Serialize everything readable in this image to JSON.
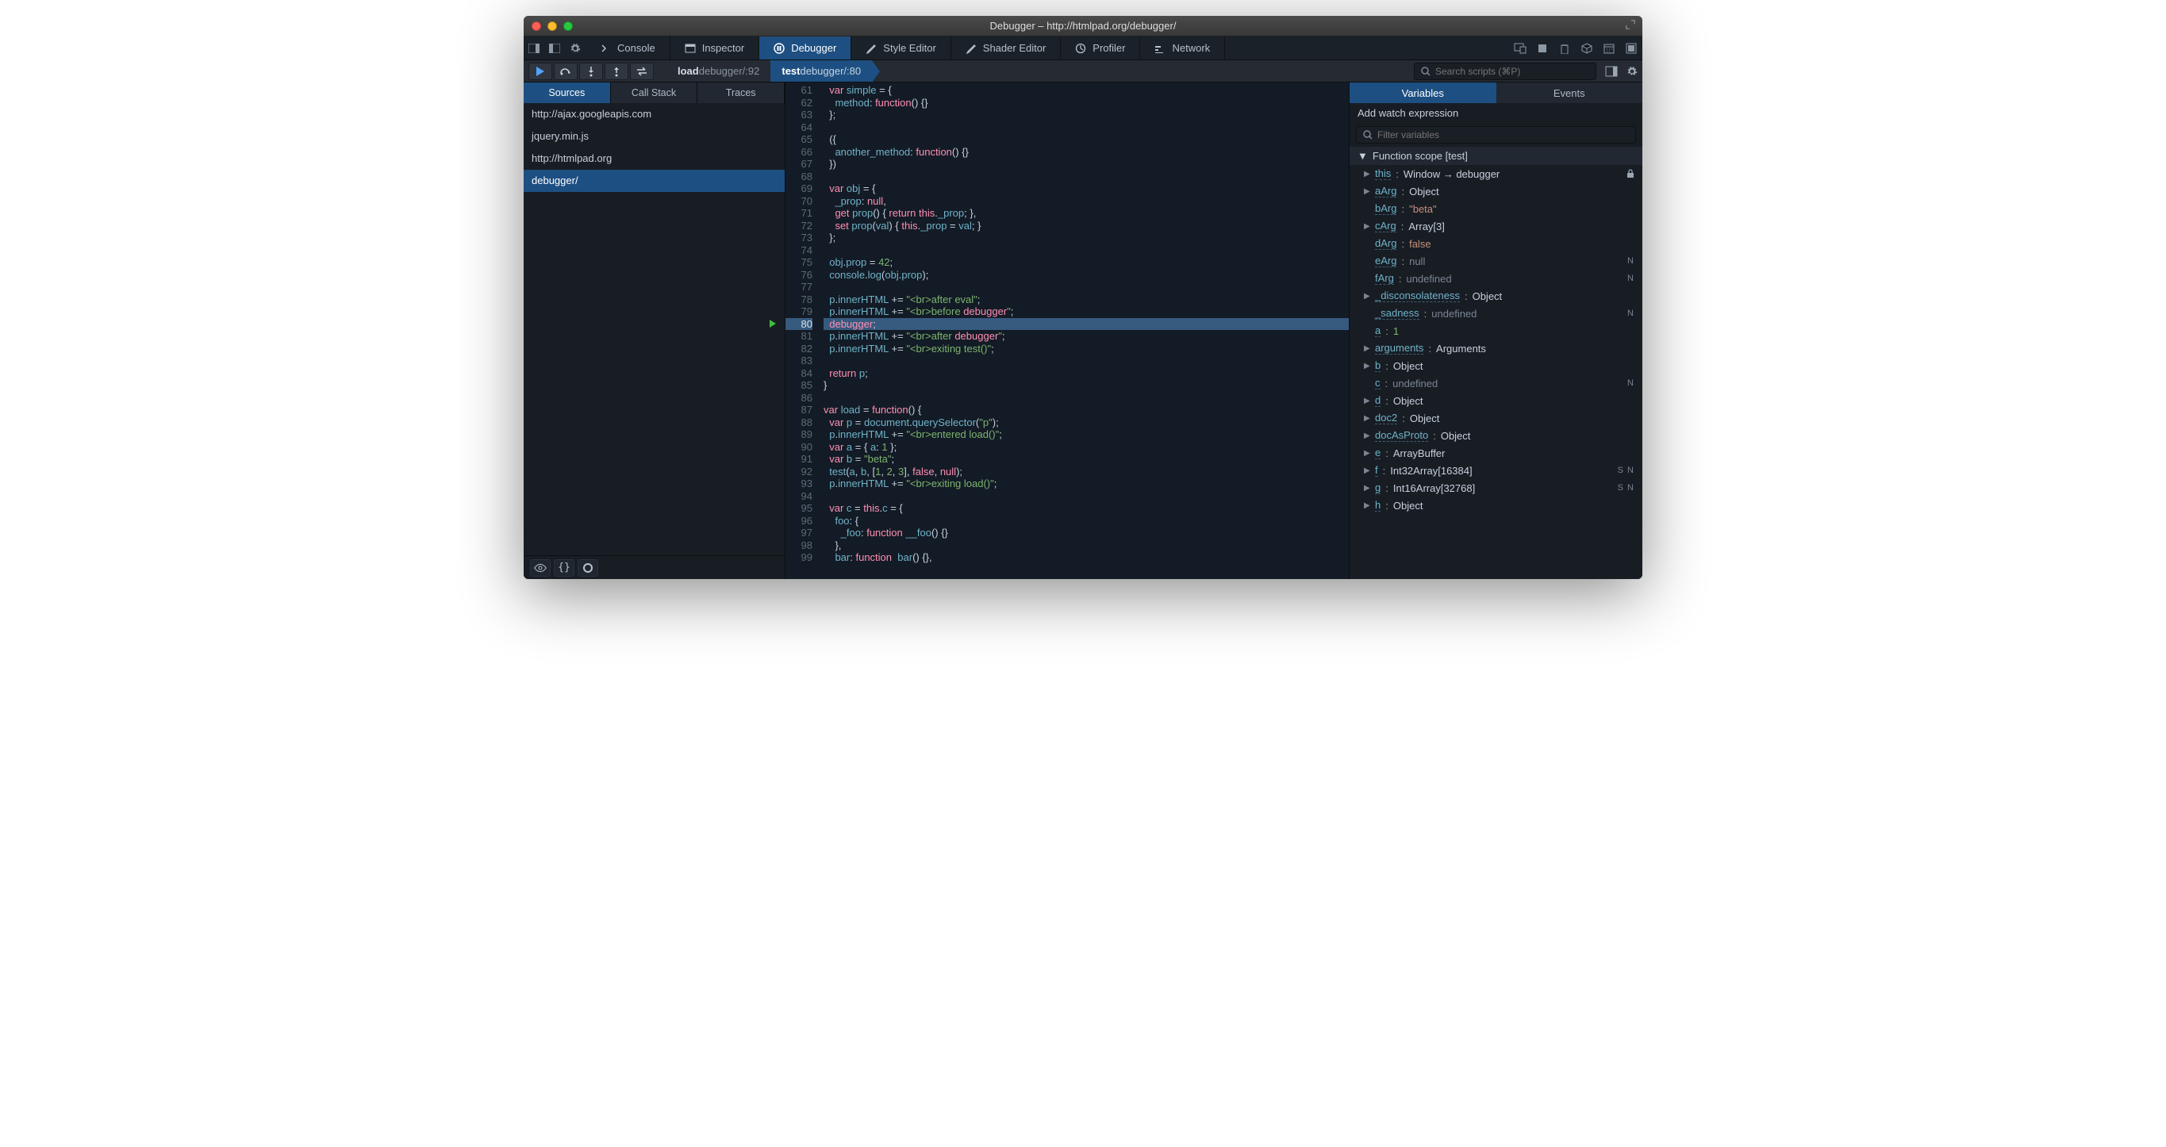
{
  "window": {
    "title": "Debugger – http://htmlpad.org/debugger/"
  },
  "tools": {
    "items": [
      {
        "label": "Console"
      },
      {
        "label": "Inspector"
      },
      {
        "label": "Debugger",
        "active": true
      },
      {
        "label": "Style Editor"
      },
      {
        "label": "Shader Editor"
      },
      {
        "label": "Profiler"
      },
      {
        "label": "Network"
      }
    ]
  },
  "breadcrumb": {
    "segments": [
      {
        "prefix": "load",
        "loc": " debugger/:92"
      },
      {
        "prefix": "test",
        "loc": " debugger/:80",
        "active": true
      }
    ]
  },
  "search": {
    "placeholder": "Search scripts (⌘P)"
  },
  "sidebar": {
    "tabs": [
      "Sources",
      "Call Stack",
      "Traces"
    ],
    "activeTab": 0,
    "sources": [
      {
        "label": "http://ajax.googleapis.com"
      },
      {
        "label": "jquery.min.js"
      },
      {
        "label": "http://htmlpad.org"
      },
      {
        "label": "debugger/",
        "selected": true
      }
    ]
  },
  "editor": {
    "firstLine": 61,
    "currentLine": 80,
    "lines": [
      "  var simple = {",
      "    method: function() {}",
      "  };",
      "",
      "  ({",
      "    another_method: function() {}",
      "  })",
      "",
      "  var obj = {",
      "    _prop: null,",
      "    get prop() { return this._prop; },",
      "    set prop(val) { this._prop = val; }",
      "  };",
      "",
      "  obj.prop = 42;",
      "  console.log(obj.prop);",
      "",
      "  p.innerHTML += \"<br>after eval\";",
      "  p.innerHTML += \"<br>before debugger\";",
      "  debugger;",
      "  p.innerHTML += \"<br>after debugger\";",
      "  p.innerHTML += \"<br>exiting test()\";",
      "",
      "  return p;",
      "}",
      "",
      "var load = function() {",
      "  var p = document.querySelector(\"p\");",
      "  p.innerHTML += \"<br>entered load()\";",
      "  var a = { a: 1 };",
      "  var b = \"beta\";",
      "  test(a, b, [1, 2, 3], false, null);",
      "  p.innerHTML += \"<br>exiting load()\";",
      "",
      "  var c = this.c = {",
      "    foo: {",
      "      _foo: function __foo() {}",
      "    },",
      "    bar: function  bar() {},"
    ]
  },
  "varpanel": {
    "tabs": [
      "Variables",
      "Events"
    ],
    "activeTab": 0,
    "watchLabel": "Add watch expression",
    "filterPlaceholder": "Filter variables",
    "scopeLabel": "Function scope [test]",
    "vars": [
      {
        "name": "this",
        "value": "Window → debugger",
        "type": "obj",
        "expand": true,
        "lock": true
      },
      {
        "name": "aArg",
        "value": "Object",
        "type": "obj",
        "expand": true
      },
      {
        "name": "bArg",
        "value": "\"beta\"",
        "type": "str"
      },
      {
        "name": "cArg",
        "value": "Array[3]",
        "type": "obj",
        "expand": true
      },
      {
        "name": "dArg",
        "value": "false",
        "type": "fal"
      },
      {
        "name": "eArg",
        "value": "null",
        "type": "nul",
        "badge": "N"
      },
      {
        "name": "fArg",
        "value": "undefined",
        "type": "und",
        "badge": "N"
      },
      {
        "name": "_disconsolateness",
        "value": "Object",
        "type": "obj",
        "expand": true
      },
      {
        "name": "_sadness",
        "value": "undefined",
        "type": "und",
        "badge": "N"
      },
      {
        "name": "a",
        "value": "1",
        "type": "num"
      },
      {
        "name": "arguments",
        "value": "Arguments",
        "type": "obj",
        "expand": true
      },
      {
        "name": "b",
        "value": "Object",
        "type": "obj",
        "expand": true
      },
      {
        "name": "c",
        "value": "undefined",
        "type": "und",
        "badge": "N"
      },
      {
        "name": "d",
        "value": "Object",
        "type": "obj",
        "expand": true
      },
      {
        "name": "doc2",
        "value": "Object",
        "type": "obj",
        "expand": true
      },
      {
        "name": "docAsProto",
        "value": "Object",
        "type": "obj",
        "expand": true
      },
      {
        "name": "e",
        "value": "ArrayBuffer",
        "type": "obj",
        "expand": true
      },
      {
        "name": "f",
        "value": "Int32Array[16384]",
        "type": "obj",
        "expand": true,
        "badge": "S N"
      },
      {
        "name": "g",
        "value": "Int16Array[32768]",
        "type": "obj",
        "expand": true,
        "badge": "S N"
      },
      {
        "name": "h",
        "value": "Object",
        "type": "obj",
        "expand": true
      }
    ]
  }
}
